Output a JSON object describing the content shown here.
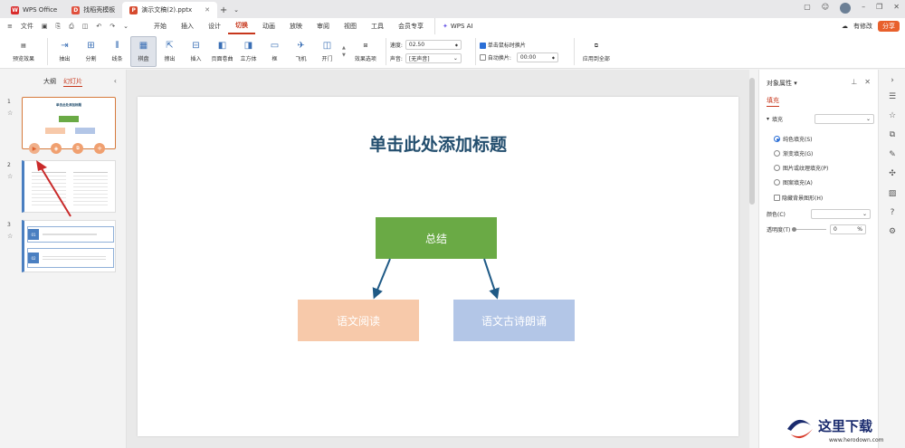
{
  "tabs": [
    {
      "label": "WPS Office",
      "icon": "wps-logo-icon",
      "color": "#d92c2c"
    },
    {
      "label": "找稻壳模板",
      "icon": "docer-icon",
      "color": "#e0503d"
    },
    {
      "label": "演示文稿(2).pptx",
      "icon": "ppt-file-icon",
      "color": "#d64a2e",
      "active": true
    }
  ],
  "menubar": {
    "file": "文件",
    "menus": [
      "开始",
      "插入",
      "设计",
      "切换",
      "动画",
      "放映",
      "审阅",
      "视图",
      "工具",
      "会员专享"
    ],
    "active_menu": "切换",
    "wps_ai": "WPS AI",
    "has_changes": "有修改",
    "share": "分享"
  },
  "ribbon": {
    "preview": "预览效果",
    "effects": [
      "抽出",
      "分割",
      "线条",
      "棋盘",
      "擦出",
      "插入",
      "页面卷曲",
      "立方体",
      "框",
      "飞机",
      "开门"
    ],
    "selected_effect": "棋盘",
    "effect_options": "效果选项",
    "speed_label": "速度:",
    "speed_value": "02.50",
    "sound_label": "声音:",
    "sound_value": "[无声音]",
    "click_switch": "单击鼠标时换片",
    "auto_switch": "自动换片:",
    "auto_time": "00:00",
    "apply_all": "应用到全部"
  },
  "left_panel": {
    "tab_outline": "大纲",
    "tab_slides": "幻灯片",
    "slides": [
      {
        "num": "1",
        "title": "单击此处添加标题"
      },
      {
        "num": "2"
      },
      {
        "num": "3",
        "item1": "01",
        "item2": "02"
      }
    ]
  },
  "slide": {
    "title": "单击此处添加标题",
    "top_box": "总结",
    "left_box": "语文阅读",
    "right_box": "语文古诗朗诵",
    "colors": {
      "top": "#6aaa45",
      "left": "#f7c9aa",
      "right": "#b3c6e7",
      "title": "#234e6e",
      "arrow": "#1f5a86"
    }
  },
  "right_panel": {
    "title": "对象属性",
    "tab": "填充",
    "fill_label": "填充",
    "options": [
      "纯色填充(S)",
      "渐变填充(G)",
      "图片或纹理填充(P)",
      "图案填充(A)"
    ],
    "selected_option": "纯色填充(S)",
    "hide_bg": "隐藏背景图形(H)",
    "color_label": "颜色(C)",
    "transparency_label": "透明度(T)",
    "transparency_value": "0",
    "percent": "%"
  }
}
